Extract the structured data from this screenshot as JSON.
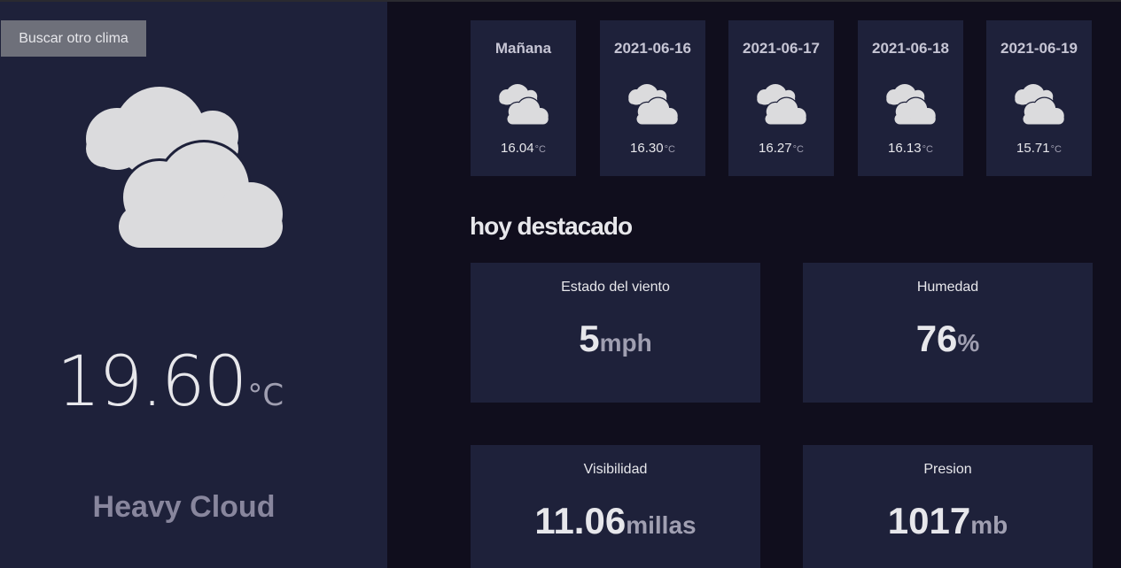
{
  "sidebar": {
    "search_button_label": "Buscar otro clima",
    "current_icon": "heavy-cloud-icon",
    "temperature": "19.60",
    "temperature_unit": "°C",
    "condition": "Heavy Cloud"
  },
  "forecast": [
    {
      "date": "Mañana",
      "icon": "heavy-cloud-icon",
      "temp": "16.04",
      "unit": "°C"
    },
    {
      "date": "2021-06-16",
      "icon": "heavy-cloud-icon",
      "temp": "16.30",
      "unit": "°C"
    },
    {
      "date": "2021-06-17",
      "icon": "heavy-cloud-icon",
      "temp": "16.27",
      "unit": "°C"
    },
    {
      "date": "2021-06-18",
      "icon": "heavy-cloud-icon",
      "temp": "16.13",
      "unit": "°C"
    },
    {
      "date": "2021-06-19",
      "icon": "heavy-cloud-icon",
      "temp": "15.71",
      "unit": "°C"
    }
  ],
  "highlights": {
    "title": "hoy destacado",
    "wind": {
      "label": "Estado del viento",
      "value": "5",
      "unit": "mph"
    },
    "humidity": {
      "label": "Humedad",
      "value": "76",
      "unit": "%"
    },
    "visibility": {
      "label": "Visibilidad",
      "value": "11.06",
      "unit": "millas"
    },
    "pressure": {
      "label": "Presion",
      "value": "1017",
      "unit": "mb"
    }
  },
  "colors": {
    "page_background": "#100e1d",
    "panel_background": "#1e213a",
    "button_background": "#6e707a",
    "text_primary": "#e7e7eb",
    "text_muted": "#a09fb1",
    "cloud": "#e7e7eb"
  }
}
